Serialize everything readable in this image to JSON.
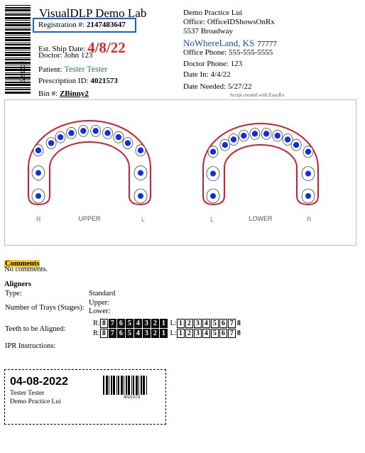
{
  "header": {
    "lab_name": "VisualDLP Demo Lab",
    "registration_label": "Registration #:",
    "registration_value": "2147483647",
    "side_barcode_text": "4021573",
    "ship_label": "Est. Ship Date:",
    "ship_date": "4/8/22",
    "doctor_label": "Doctor:",
    "doctor_value": "John 123",
    "patient_label": "Patient:",
    "patient_value": "Tester Tester",
    "rx_label": "Prescription ID:",
    "rx_value": "4021573",
    "bin_label": "Bin #:",
    "bin_value": "ZBinny2"
  },
  "practice": {
    "name": "Demo Practice Lui",
    "office": "Office: OfficeIDShowsOnRx",
    "address": "5537 Broadway",
    "city": "NoWhereLand, KS",
    "zip": "77777",
    "office_phone": "Office Phone: 555-555-5555",
    "doctor_phone": "Doctor Phone: 123",
    "date_in": "Date In: 4/4/22",
    "date_needed": "Date Needed: 5/27/22",
    "credit": "Script created with EasyRx"
  },
  "arches": {
    "upper": {
      "label": "UPPER",
      "left_side": "R",
      "right_side": "L"
    },
    "lower": {
      "label": "LOWER",
      "left_side": "L",
      "right_side": "R"
    },
    "colors": {
      "outline": "#d0202a",
      "dot": "#1030e0"
    }
  },
  "comments": {
    "label": "Comments",
    "text": "No comments."
  },
  "aligners": {
    "heading": "Aligners",
    "type_label": "Type:",
    "type_value": "Standard",
    "trays_label": "Number of Trays (Stages):",
    "upper_label": "Upper:",
    "lower_label": "Lower:",
    "teeth_label": "Teeth to be Aligned:",
    "r_label": "R:",
    "l_label": "L:",
    "r_teeth": [
      "8",
      "7",
      "6",
      "5",
      "4",
      "3",
      "2",
      "1"
    ],
    "l_teeth": [
      "1",
      "2",
      "3",
      "4",
      "5",
      "6",
      "7",
      "8"
    ],
    "ipr_label": "IPR Instructions:"
  },
  "ticket": {
    "date": "04-08-2022",
    "patient": "Tester Tester",
    "practice": "Demo Practice Lui",
    "barcode_text": "4021573"
  }
}
